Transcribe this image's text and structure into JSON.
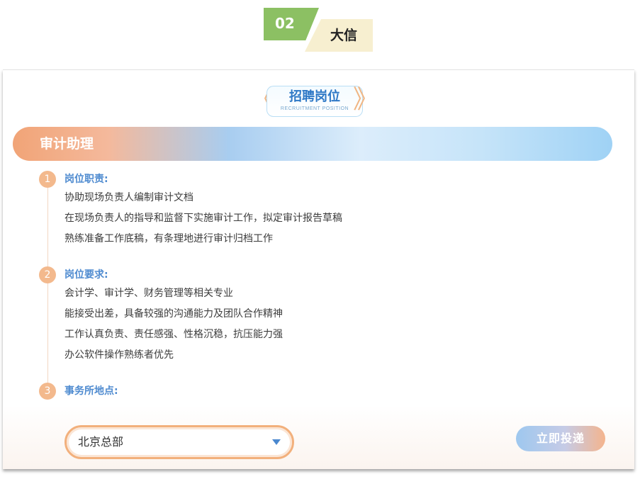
{
  "header": {
    "number": "02",
    "company": "大信"
  },
  "page": {
    "title": "招聘岗位",
    "title_en": "RECRUITMENT POSITION",
    "chevron_left": "《",
    "chevron_right": "》"
  },
  "job": {
    "name": "审计助理"
  },
  "sections": [
    {
      "number": "1",
      "title": "岗位职责:",
      "lines": [
        "协助现场负责人编制审计文档",
        "在现场负责人的指导和监督下实施审计工作，拟定审计报告草稿",
        "熟练准备工作底稿，有条理地进行审计归档工作"
      ]
    },
    {
      "number": "2",
      "title": "岗位要求:",
      "lines": [
        "会计学、审计学、财务管理等相关专业",
        "能接受出差，具备较强的沟通能力及团队合作精神",
        "工作认真负责、责任感强、性格沉稳，抗压能力强",
        "办公软件操作熟练者优先"
      ]
    },
    {
      "number": "3",
      "title": "事务所地点:",
      "lines": []
    }
  ],
  "office_select": {
    "value": "北京总部"
  },
  "apply_button": {
    "label": "立即投递"
  },
  "colors": {
    "tag_green": "#8cc063",
    "tag_cream": "#f7efd0",
    "accent_orange": "#f3b98d",
    "accent_blue": "#4f8bd0"
  },
  "icons": {
    "dropdown": "chevron-down-icon"
  }
}
